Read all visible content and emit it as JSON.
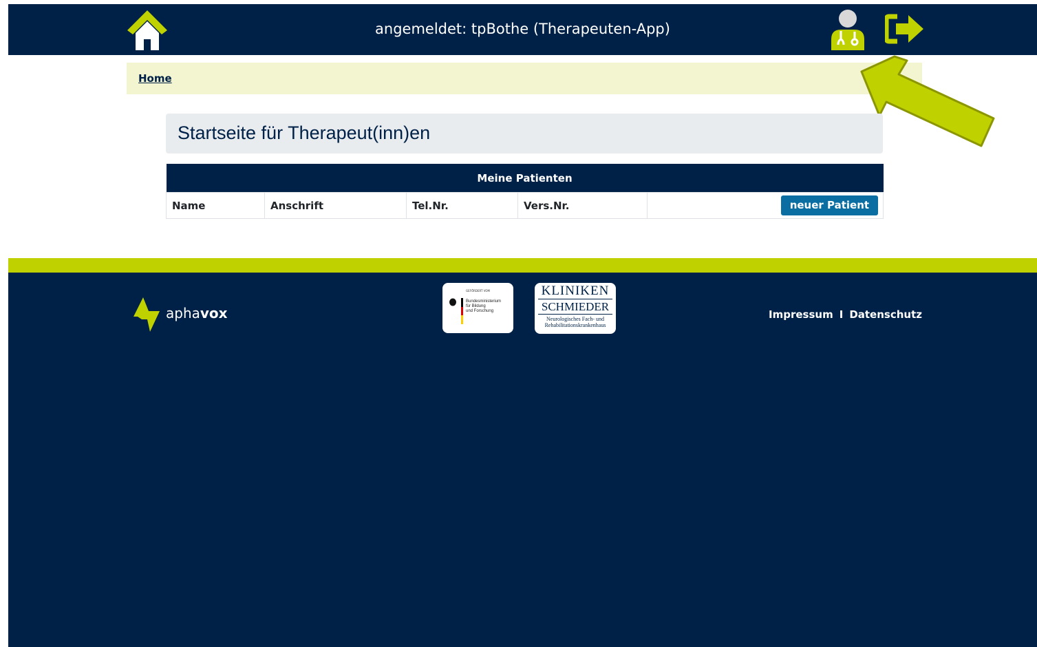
{
  "header": {
    "login_text": "angemeldet: tpBothe (Therapeuten-App)",
    "icons": [
      "home-icon",
      "doctor-user-icon",
      "logout-icon"
    ],
    "accent_color": "#c0d100",
    "bar_color": "#002147"
  },
  "breadcrumb": {
    "home_label": "Home"
  },
  "main": {
    "title": "Startseite für Therapeut(inn)en",
    "table": {
      "caption": "Meine Patienten",
      "columns": [
        "Name",
        "Anschrift",
        "Tel.Nr.",
        "Vers.Nr."
      ],
      "new_patient_label": "neuer Patient",
      "rows": []
    }
  },
  "footer": {
    "brand_light": "apha",
    "brand_bold": "vox",
    "bmbf": {
      "top": "GEFÖRDERT VOM",
      "name": "Bundesministerium\nfür Bildung\nund Forschung"
    },
    "kliniken": {
      "line1": "KLINIKEN",
      "line2": "SCHMIEDER",
      "line3": "Neurologisches Fach- und",
      "line4": "Rehabilitationskrankenhaus"
    },
    "impressum_label": "Impressum",
    "separator": "I",
    "datenschutz_label": "Datenschutz"
  }
}
